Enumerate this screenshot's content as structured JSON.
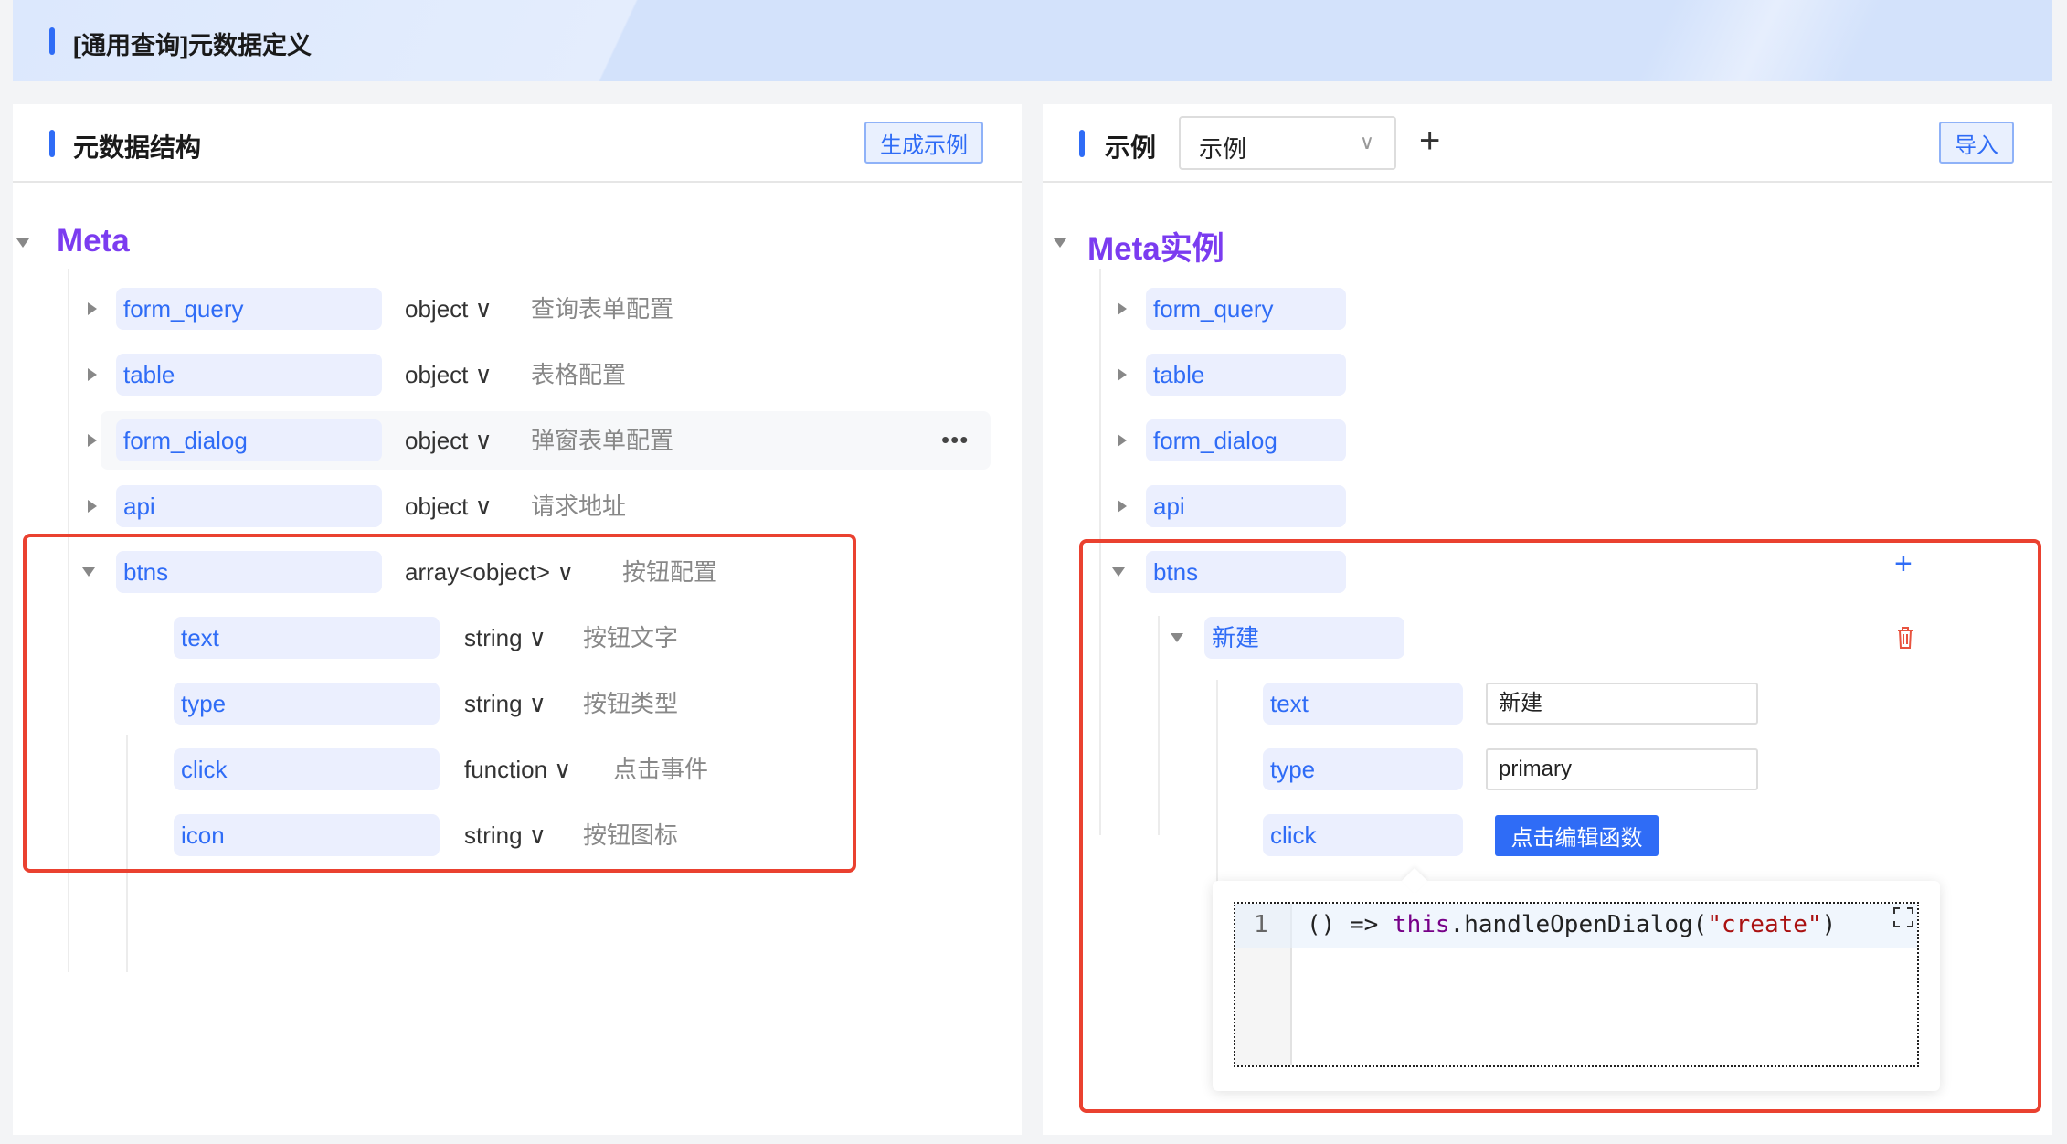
{
  "page": {
    "title": "[通用查询]元数据定义"
  },
  "left": {
    "title": "元数据结构",
    "generate_button": "生成示例",
    "root": "Meta",
    "rows": [
      {
        "key": "form_query",
        "type": "object",
        "desc": "查询表单配置"
      },
      {
        "key": "table",
        "type": "object",
        "desc": "表格配置"
      },
      {
        "key": "form_dialog",
        "type": "object",
        "desc": "弹窗表单配置"
      },
      {
        "key": "api",
        "type": "object",
        "desc": "请求地址"
      },
      {
        "key": "btns",
        "type": "array<object>",
        "desc": "按钮配置"
      }
    ],
    "children": [
      {
        "key": "text",
        "type": "string",
        "desc": "按钮文字"
      },
      {
        "key": "type",
        "type": "string",
        "desc": "按钮类型"
      },
      {
        "key": "click",
        "type": "function",
        "desc": "点击事件"
      },
      {
        "key": "icon",
        "type": "string",
        "desc": "按钮图标"
      }
    ],
    "more_icon": "ellipsis-icon"
  },
  "right": {
    "title": "示例",
    "select_value": "示例",
    "import_button": "导入",
    "root": "Meta实例",
    "rows": [
      "form_query",
      "table",
      "form_dialog",
      "api",
      "btns"
    ],
    "item": "新建",
    "fields": [
      {
        "key": "text",
        "value": "新建"
      },
      {
        "key": "type",
        "value": "primary"
      },
      {
        "key": "click",
        "button": "点击编辑函数"
      }
    ],
    "editor": {
      "line": "1",
      "code_paren": "() =>",
      "code_this": "this",
      "code_call": ".handleOpenDialog(",
      "code_str": "\"create\"",
      "code_end": ")"
    }
  },
  "colors": {
    "accent": "#2f6cf6",
    "root": "#7b3cf0",
    "highlight": "#ea4130",
    "delete": "#e8533f"
  }
}
